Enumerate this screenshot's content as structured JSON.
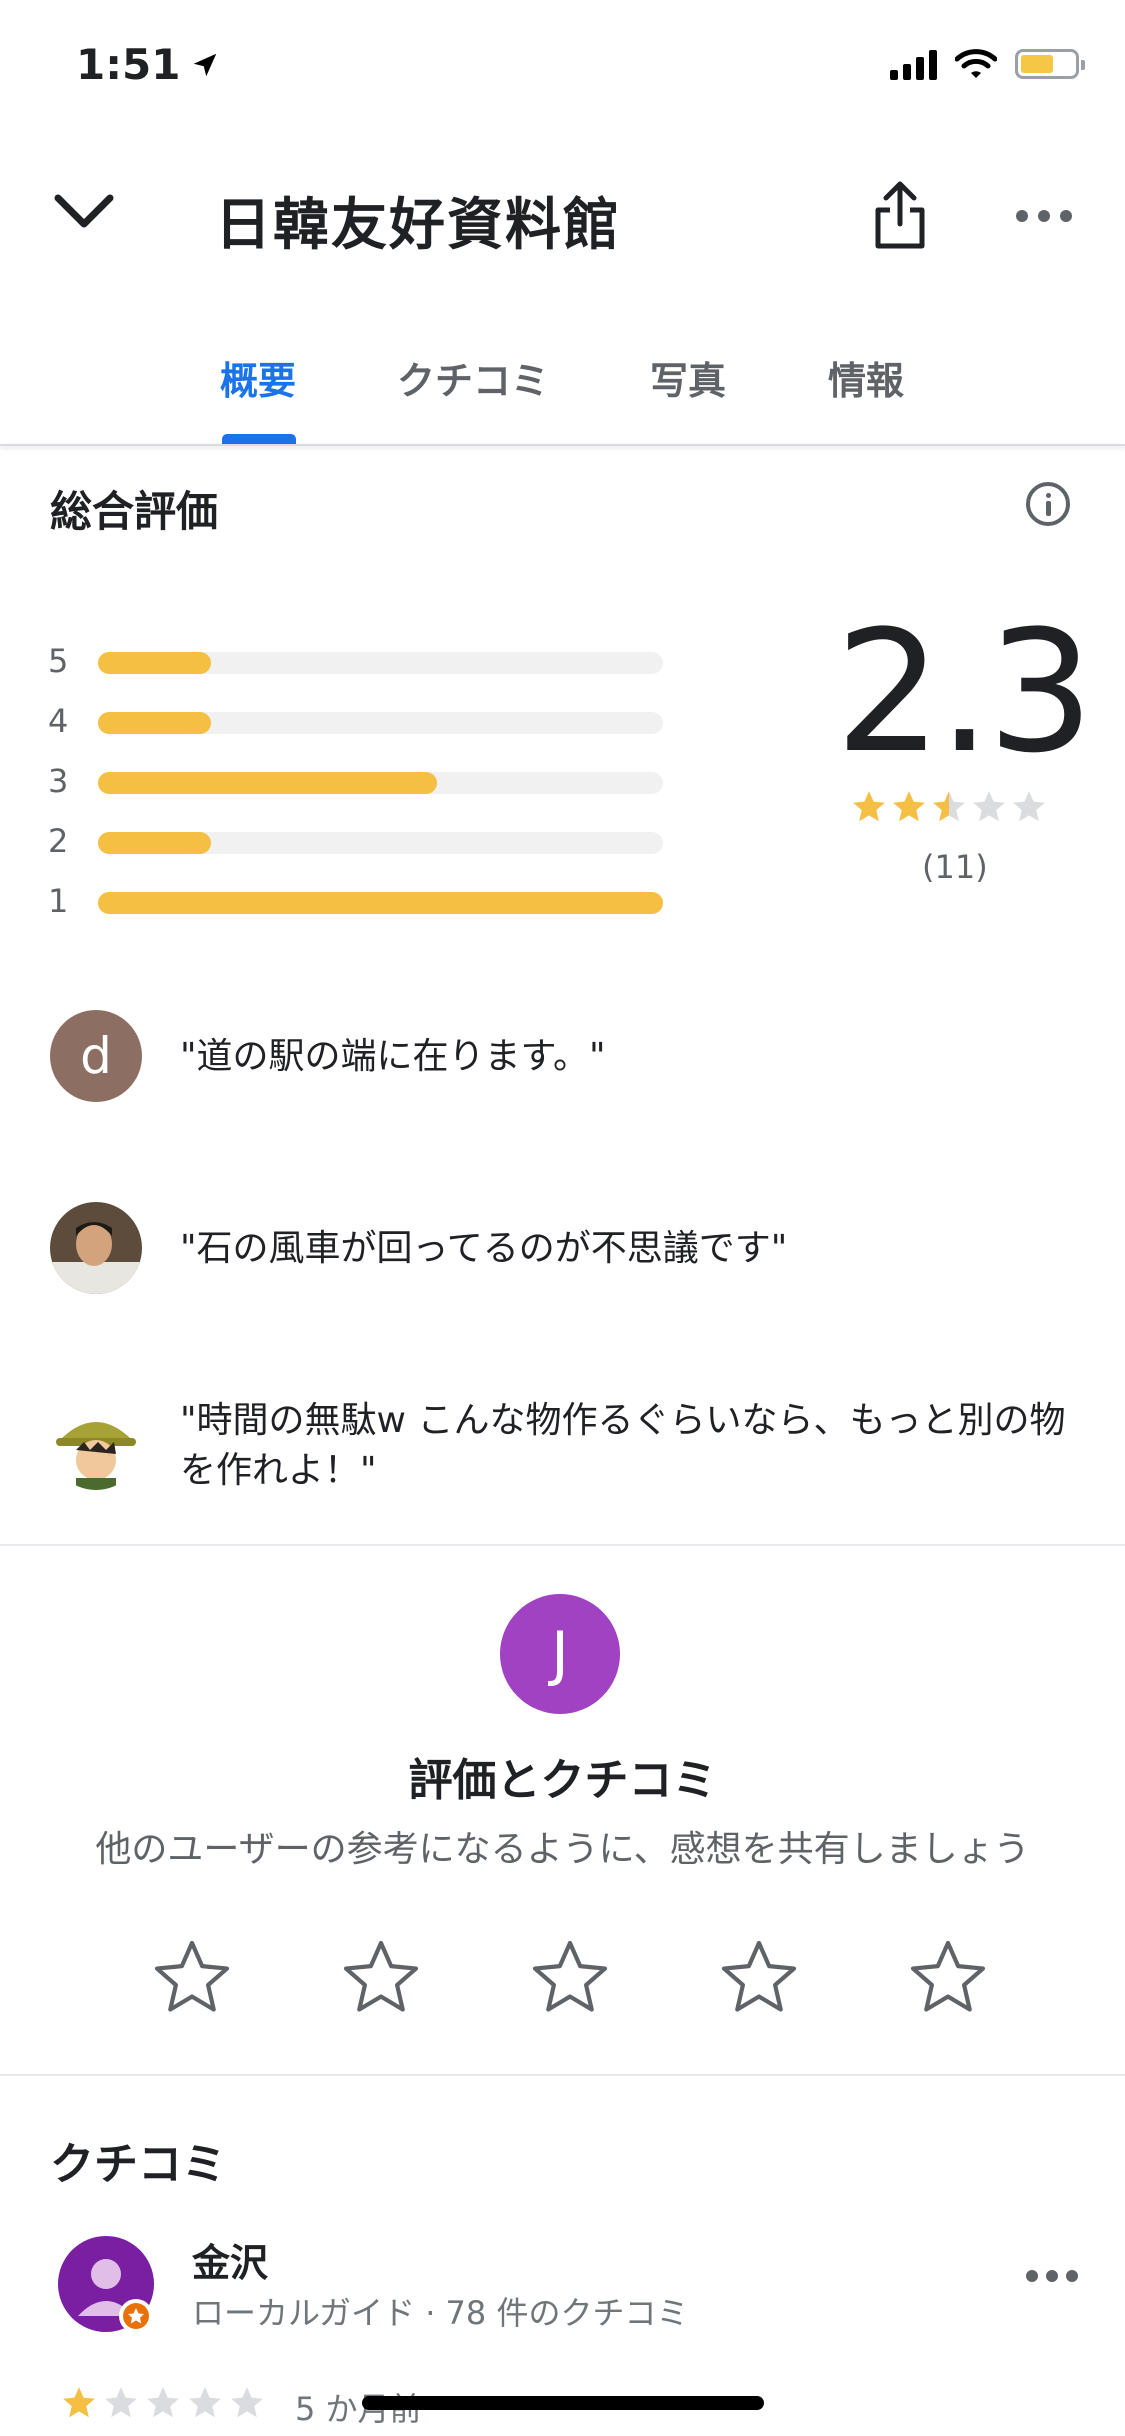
{
  "status_bar": {
    "time": "1:51"
  },
  "header": {
    "title": "日韓友好資料館"
  },
  "tabs": [
    {
      "label": "概要",
      "active": true
    },
    {
      "label": "クチコミ"
    },
    {
      "label": "写真"
    },
    {
      "label": "情報"
    }
  ],
  "rating_summary": {
    "title": "総合評価",
    "average": "2.3",
    "count": "(11)",
    "distribution": [
      {
        "label": "5",
        "fraction": 0.2
      },
      {
        "label": "4",
        "fraction": 0.2
      },
      {
        "label": "3",
        "fraction": 0.6
      },
      {
        "label": "2",
        "fraction": 0.2
      },
      {
        "label": "1",
        "fraction": 1.0
      }
    ]
  },
  "snippets": [
    {
      "avatar_letter": "d",
      "text": "\"道の駅の端に在ります。\""
    },
    {
      "avatar_letter": "",
      "text": "\"石の風車が回ってるのが不思議です\""
    },
    {
      "avatar_letter": "",
      "text": "\"時間の無駄w こんな物作るぐらいなら、もっと別の物を作れよ！\""
    }
  ],
  "rate_review": {
    "avatar_letter": "J",
    "title": "評価とクチコミ",
    "subtitle": "他のユーザーの参考になるように、感想を共有しましょう"
  },
  "reviews": {
    "title": "クチコミ",
    "items": [
      {
        "name": "金沢",
        "meta": "ローカルガイド · 78 件のクチコミ",
        "stars": 1,
        "time": "5 か月前"
      }
    ]
  },
  "colors": {
    "accent": "#1a73e8",
    "star": "#f4bf42",
    "avatar_purple": "#a142c2"
  }
}
